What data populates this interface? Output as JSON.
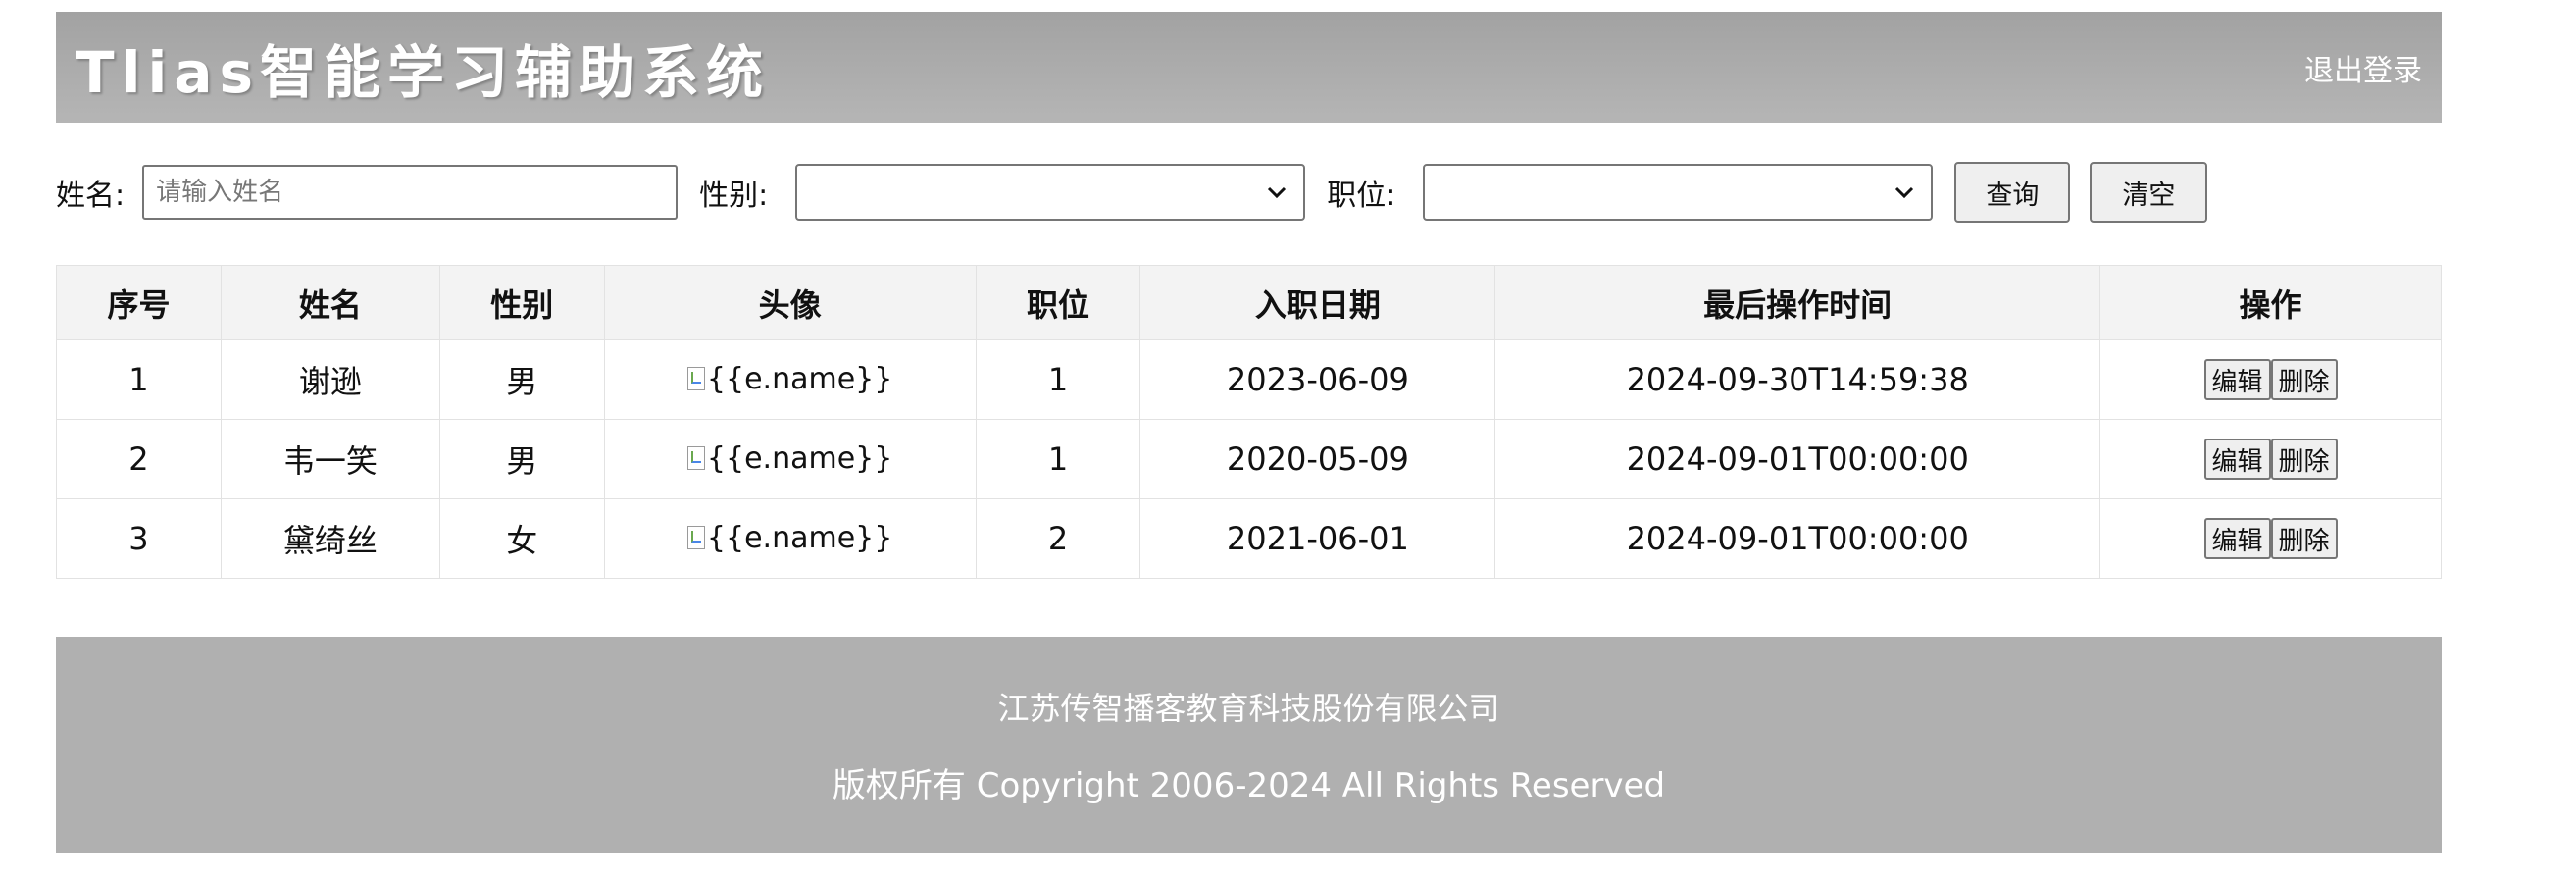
{
  "header": {
    "title": "Tlias智能学习辅助系统",
    "logout_label": "退出登录"
  },
  "search": {
    "name_label": "姓名:",
    "name_placeholder": "请输入姓名",
    "name_value": "",
    "gender_label": "性别:",
    "gender_value": "",
    "job_label": "职位:",
    "job_value": "",
    "query_label": "查询",
    "clear_label": "清空"
  },
  "table": {
    "columns": [
      "序号",
      "姓名",
      "性别",
      "头像",
      "职位",
      "入职日期",
      "最后操作时间",
      "操作"
    ],
    "rows": [
      {
        "index": "1",
        "name": "谢逊",
        "gender": "男",
        "avatar_alt": "{{e.name}}",
        "job": "1",
        "entry_date": "2023-06-09",
        "update_time": "2024-09-30T14:59:38",
        "edit": "编辑",
        "delete": "删除"
      },
      {
        "index": "2",
        "name": "韦一笑",
        "gender": "男",
        "avatar_alt": "{{e.name}}",
        "job": "1",
        "entry_date": "2020-05-09",
        "update_time": "2024-09-01T00:00:00",
        "edit": "编辑",
        "delete": "删除"
      },
      {
        "index": "3",
        "name": "黛绮丝",
        "gender": "女",
        "avatar_alt": "{{e.name}}",
        "job": "2",
        "entry_date": "2021-06-01",
        "update_time": "2024-09-01T00:00:00",
        "edit": "编辑",
        "delete": "删除"
      }
    ]
  },
  "footer": {
    "company": "江苏传智播客教育科技股份有限公司",
    "copyright": "版权所有 Copyright 2006-2024 All Rights Reserved"
  },
  "icons": {
    "select_arrow": "chevron-down-icon",
    "avatar": "broken-image-icon"
  },
  "colors": {
    "header_bg": "#a8a8a8",
    "footer_bg": "#b0b0b0",
    "table_header_bg": "#f3f3f3"
  }
}
